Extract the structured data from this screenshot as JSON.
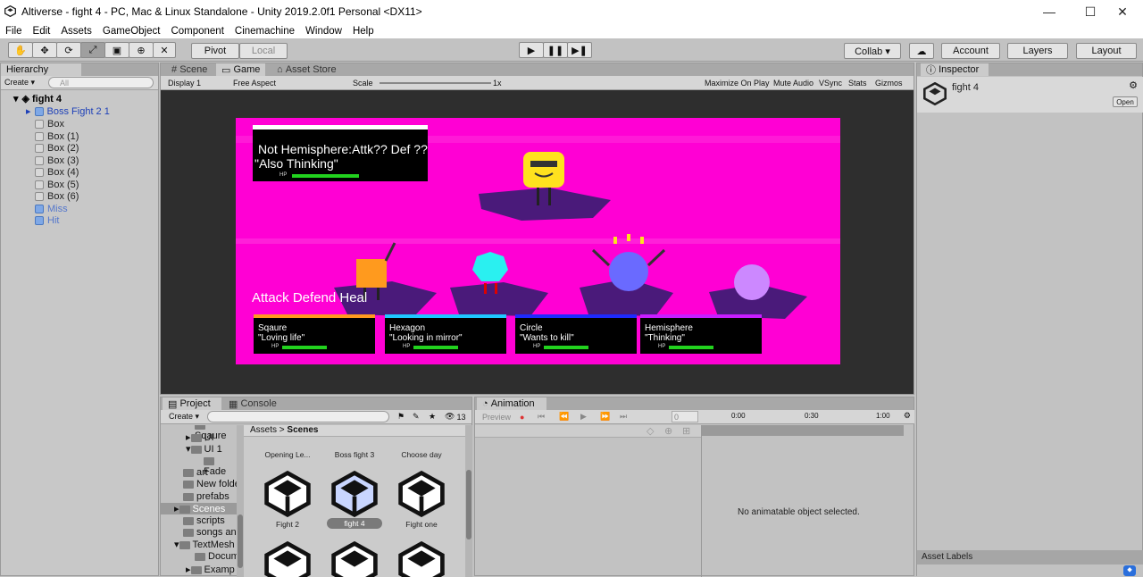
{
  "window": {
    "title": "Altiverse - fight 4 - PC, Mac & Linux Standalone - Unity 2019.2.0f1 Personal <DX11>",
    "min_symbol": "—",
    "max_symbol": "☐",
    "close_symbol": "✕"
  },
  "menu": [
    "File",
    "Edit",
    "Assets",
    "GameObject",
    "Component",
    "Cinemachine",
    "Window",
    "Help"
  ],
  "toolbar": {
    "pivot": "Pivot",
    "local": "Local",
    "collab": "Collab ▾",
    "account": "Account",
    "layers": "Layers",
    "layout": "Layout"
  },
  "hierarchy": {
    "tab": "Hierarchy",
    "create": "Create ▾",
    "search_placeholder": "All",
    "scene": "fight 4",
    "items": [
      {
        "label": "Boss Fight 2 1",
        "prefab": true
      },
      {
        "label": "Box"
      },
      {
        "label": "Box (1)"
      },
      {
        "label": "Box (2)"
      },
      {
        "label": "Box (3)"
      },
      {
        "label": "Box (4)"
      },
      {
        "label": "Box (5)"
      },
      {
        "label": "Box (6)"
      },
      {
        "label": "Miss",
        "prefab": true
      },
      {
        "label": "Hit",
        "prefab": true
      }
    ]
  },
  "scene_tabs": {
    "scene": "Scene",
    "game": "Game",
    "asset_store": "Asset Store"
  },
  "game_bar": {
    "display": "Display 1",
    "aspect": "Free Aspect",
    "scale_label": "Scale",
    "scale_value": "1x",
    "maximize": "Maximize On Play",
    "mute": "Mute Audio",
    "vsync": "VSync",
    "stats": "Stats",
    "gizmos": "Gizmos"
  },
  "game": {
    "enemy": {
      "line1": "Not Hemisphere:Attk?? Def ??",
      "line2": "\"Also Thinking\"",
      "hp": "HP"
    },
    "actions": "Attack  Defend  Heal",
    "party": [
      {
        "name": "Sqaure",
        "quote": "\"Loving life\"",
        "hp": "HP",
        "accent": "#ff9a1e"
      },
      {
        "name": "Hexagon",
        "quote": "\"Looking in mirror\"",
        "hp": "HP",
        "accent": "#1ec8ff"
      },
      {
        "name": "Circle",
        "quote": "\"Wants to kill\"",
        "hp": "HP",
        "accent": "#1e2aff"
      },
      {
        "name": "Hemisphere",
        "quote": "\"Thinking\"",
        "hp": "HP",
        "accent": "#c81eff"
      }
    ]
  },
  "inspector": {
    "tab": "Inspector",
    "object": "fight 4",
    "open": "Open",
    "asset_labels": "Asset Labels"
  },
  "project": {
    "tab": "Project",
    "console": "Console",
    "create": "Create ▾",
    "count": "13",
    "tree": [
      "Sqaure",
      "UI",
      "UI 1",
      "Fade",
      "art",
      "New folde",
      "prefabs",
      "Scenes",
      "scripts",
      "songs an",
      "TextMesh",
      "Docum",
      "Examp"
    ],
    "breadcrumb_root": "Assets",
    "breadcrumb_sep": ">",
    "breadcrumb_current": "Scenes",
    "assets_row1": [
      "Opening Le...",
      "Boss fight 3",
      "Choose day"
    ],
    "assets_row2": [
      "Fight 2",
      "fight 4",
      "Fight one"
    ]
  },
  "animation": {
    "tab": "Animation",
    "preview": "Preview",
    "frame": "0",
    "t0": "0:00",
    "t1": "0:30",
    "t2": "1:00",
    "empty": "No animatable object selected."
  }
}
